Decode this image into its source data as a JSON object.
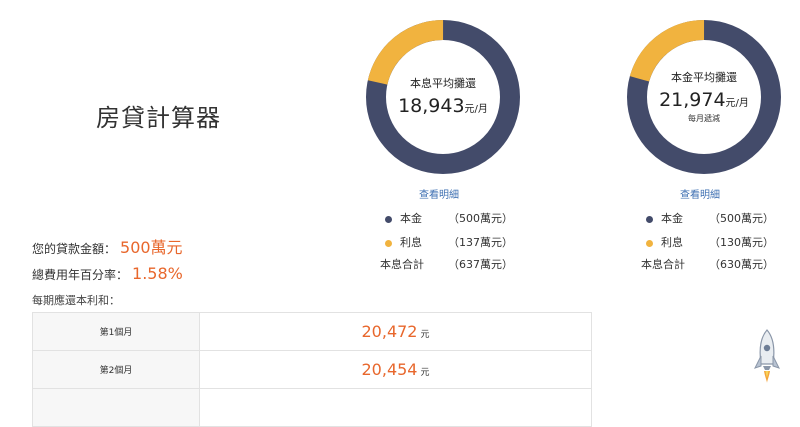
{
  "title": "房貸計算器",
  "summary": {
    "loan_label": "您的貸款金額：",
    "loan_value": "500萬元",
    "rate_label": "總費用年百分率：",
    "rate_value": "1.58%",
    "schedule_label": "每期應還本利和："
  },
  "plans": [
    {
      "center_label": "本息平均攤還",
      "amount": "18,943",
      "unit": "元/月",
      "note": "",
      "link": "查看明細",
      "principal": 500,
      "interest": 137,
      "legend": [
        {
          "name": "本金",
          "amount": "（500萬元）"
        },
        {
          "name": "利息",
          "amount": "（137萬元）"
        },
        {
          "name": "本息合計",
          "amount": "（637萬元）"
        }
      ]
    },
    {
      "center_label": "本金平均攤還",
      "amount": "21,974",
      "unit": "元/月",
      "note": "每月遞減",
      "link": "查看明細",
      "principal": 500,
      "interest": 130,
      "legend": [
        {
          "name": "本金",
          "amount": "（500萬元）"
        },
        {
          "name": "利息",
          "amount": "（130萬元）"
        },
        {
          "name": "本息合計",
          "amount": "（630萬元）"
        }
      ]
    }
  ],
  "colors": {
    "principal": "#434b6a",
    "interest": "#f1b33f",
    "accent": "#e8672c",
    "link": "#3d6fb2"
  },
  "schedule": [
    {
      "period": "第1個月",
      "amount": "20,472",
      "unit": "元"
    },
    {
      "period": "第2個月",
      "amount": "20,454",
      "unit": "元"
    }
  ],
  "icons": {
    "back_to_top": "rocket-icon"
  }
}
